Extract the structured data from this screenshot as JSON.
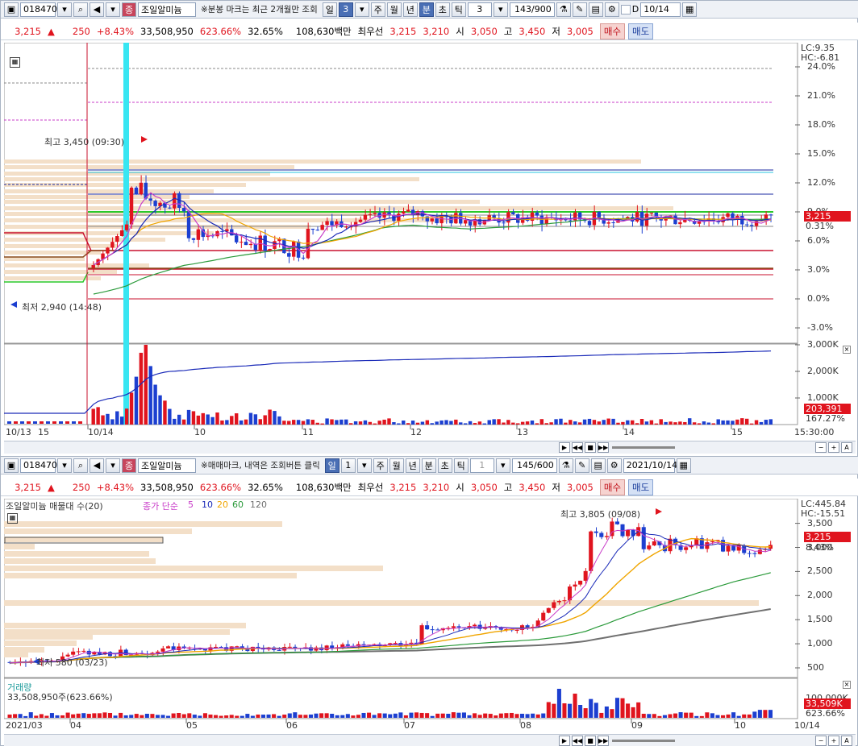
{
  "top": {
    "toolbar": {
      "code": "018470",
      "name": "조일알미늄",
      "name_badge": "종",
      "notice": "※분봉 마크는 최근 2개월만 조회",
      "period_day": "일",
      "period_num": "3",
      "week": "주",
      "month": "월",
      "year": "년",
      "minute": "분",
      "second": "초",
      "tick": "틱",
      "interval": "3",
      "count": "143/900",
      "date_flag": "D",
      "date": "10/14"
    },
    "quote": {
      "price": "3,215",
      "arrow": "▲",
      "change": "250",
      "rate": "+8.43%",
      "volume": "33,508,950",
      "vol_rate": "623.66%",
      "turnover": "32.65%",
      "amount": "108,630백만",
      "best_label": "최우선",
      "best_ask": "3,215",
      "best_bid": "3,210",
      "open_label": "시",
      "open": "3,050",
      "high_label": "고",
      "high": "3,450",
      "low_label": "저",
      "low": "3,005",
      "buy": "매수",
      "sell": "매도"
    },
    "price_axis": [
      "24.0%",
      "21.0%",
      "18.0%",
      "15.0%",
      "12.0%",
      "9.0%",
      "6.0%",
      "3.0%",
      "0.0%",
      "-3.0%"
    ],
    "lc": "LC:9.35",
    "hc": "HC:-6.81",
    "cur_price_tag": "3,215",
    "cur_pct_tag": "0.31%",
    "high_label": "최고 3,450 (09:30)",
    "low_label": "최저 2,940 (14:48)",
    "vol_axis": [
      "3,000K",
      "2,000K",
      "1,000K"
    ],
    "vol_tag": "203,391",
    "vol_pct_tag": "167.27%",
    "x_labels": [
      "10/13",
      "15",
      "10/14",
      "10",
      "11",
      "12",
      "13",
      "14",
      "15",
      "15:30:00"
    ]
  },
  "bottom": {
    "toolbar": {
      "code": "018470",
      "name": "조일알미늄",
      "name_badge": "종",
      "notice": "※매매마크, 내역은 조회버튼 클릭",
      "period_day": "일",
      "period_num": "1",
      "week": "주",
      "month": "월",
      "year": "년",
      "minute": "분",
      "second": "초",
      "tick": "틱",
      "interval": "1",
      "count": "145/600",
      "date": "2021/10/14"
    },
    "quote": {
      "price": "3,215",
      "arrow": "▲",
      "change": "250",
      "rate": "+8.43%",
      "volume": "33,508,950",
      "vol_rate": "623.66%",
      "turnover": "32.65%",
      "amount": "108,630백만",
      "best_label": "최우선",
      "best_ask": "3,215",
      "best_bid": "3,210",
      "open_label": "시",
      "open": "3,050",
      "high_label": "고",
      "high": "3,450",
      "low_label": "저",
      "low": "3,005",
      "buy": "매수",
      "sell": "매도"
    },
    "legend_title": "조일알미늄 매물대 수(20)",
    "legend_ma": "종가 단순",
    "ma_periods": [
      "5",
      "10",
      "20",
      "60",
      "120"
    ],
    "price_axis": [
      "3,500",
      "3,000",
      "2,500",
      "2,000",
      "1,500",
      "1,000",
      "500"
    ],
    "lc": "LC:445.84",
    "hc": "HC:-15.51",
    "cur_price_tag": "3,215",
    "cur_pct_tag": "8.43%",
    "high_label": "최고 3,805 (09/08)",
    "low_label": "최저 580 (03/23)",
    "vol_title": "거래량",
    "vol_value": "33,508,950주(623.66%)",
    "vol_axis": "100,000K",
    "vol_tag": "33,509K",
    "vol_pct_tag": "623.66%",
    "x_labels": [
      "2021/03",
      "04",
      "05",
      "06",
      "07",
      "08",
      "09",
      "10",
      "10/14"
    ]
  },
  "colors": {
    "up": "#e0141e",
    "down": "#1c3fd0",
    "cyan": "#38e6f2",
    "ma5": "#c83cc8",
    "ma10": "#1a2ab8",
    "ma20": "#f0a500",
    "ma60": "#2a9a3a",
    "ma120": "#707070",
    "volume_profile": "#f3dfc8"
  }
}
